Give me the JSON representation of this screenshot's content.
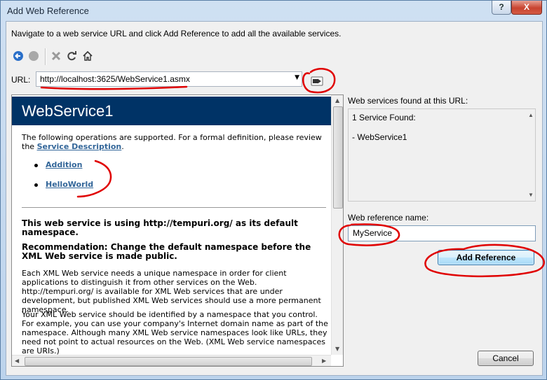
{
  "window": {
    "title": "Add Web Reference",
    "help_label": "?",
    "close_label": "X"
  },
  "intro_text": "Navigate to a web service URL and click Add Reference to add all the available services.",
  "toolbar": {
    "icons": [
      "back-icon",
      "forward-icon",
      "stop-icon",
      "refresh-icon",
      "home-icon"
    ]
  },
  "url": {
    "label": "URL:",
    "value": "http://localhost:3625/WebService1.asmx"
  },
  "browser": {
    "service_title": "WebService1",
    "ops_intro": "The following operations are supported. For a formal definition, please review the",
    "service_description_link": "Service Description",
    "operations": [
      "Addition",
      "HelloWorld"
    ],
    "namespace_heading": "This web service is using http://tempuri.org/ as its default namespace.",
    "recommendation_heading": "Recommendation: Change the default namespace before the XML Web service is made public.",
    "para1": "Each XML Web service needs a unique namespace in order for client applications to distinguish it from other services on the Web. http://tempuri.org/ is available for XML Web services that are under development, but published XML Web services should use a more permanent namespace.",
    "para2": "Your XML Web service should be identified by a namespace that you control. For example, you can use your company's Internet domain name as part of the namespace. Although many XML Web service namespaces look like URLs, they need not point to actual resources on the Web. (XML Web service namespaces are URIs.)"
  },
  "services_found": {
    "label": "Web services found at this URL:",
    "count_text": "1 Service Found:",
    "items": [
      "- WebService1"
    ]
  },
  "reference_name": {
    "label": "Web reference name:",
    "value": "MyService"
  },
  "buttons": {
    "add_reference": "Add Reference",
    "cancel": "Cancel"
  },
  "colors": {
    "header_bg": "#003366",
    "link": "#336699",
    "annotation": "#e00000"
  }
}
